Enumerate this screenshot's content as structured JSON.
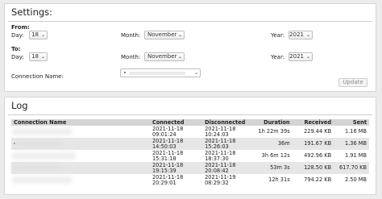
{
  "settings": {
    "title": "Settings:",
    "from_label": "From:",
    "to_label": "To:",
    "day_label": "Day:",
    "month_label": "Month:",
    "year_label": "Year:",
    "from": {
      "day": "18",
      "month": "November",
      "year": "2021"
    },
    "to": {
      "day": "18",
      "month": "November",
      "year": "2021"
    },
    "connection_name_label": "Connection Name:",
    "connection_name_value": "",
    "update_label": "Update"
  },
  "log": {
    "title": "Log",
    "columns": [
      "Connection Name",
      "Connected",
      "Disconnected",
      "Duration",
      "Received",
      "Sent"
    ],
    "rows": [
      {
        "name": "",
        "connected_date": "2021-11-18",
        "connected_time": "09:01:24",
        "disconnected_date": "2021-11-18",
        "disconnected_time": "10:24:03",
        "duration": "1h 22m 39s",
        "received": "229.44 KB",
        "sent": "1.16 MB"
      },
      {
        "name": "",
        "connected_date": "2021-11-18",
        "connected_time": "14:50:03",
        "disconnected_date": "2021-11-18",
        "disconnected_time": "15:26:03",
        "duration": "36m",
        "received": "191.67 KB",
        "sent": "1.36 MB"
      },
      {
        "name": "",
        "connected_date": "2021-11-18",
        "connected_time": "15:31:18",
        "disconnected_date": "2021-11-18",
        "disconnected_time": "18:37:30",
        "duration": "3h 6m 12s",
        "received": "492.96 KB",
        "sent": "1.91 MB"
      },
      {
        "name": "",
        "connected_date": "2021-11-18",
        "connected_time": "19:15:39",
        "disconnected_date": "2021-11-18",
        "disconnected_time": "20:08:42",
        "duration": "53m 3s",
        "received": "128.50 KB",
        "sent": "617.70 KB"
      },
      {
        "name": "",
        "connected_date": "2021-11-18",
        "connected_time": "20:29:01",
        "disconnected_date": "2021-11-19",
        "disconnected_time": "08:29:32",
        "duration": "12h 31s",
        "received": "794.22 KB",
        "sent": "2.50 MB"
      }
    ]
  }
}
